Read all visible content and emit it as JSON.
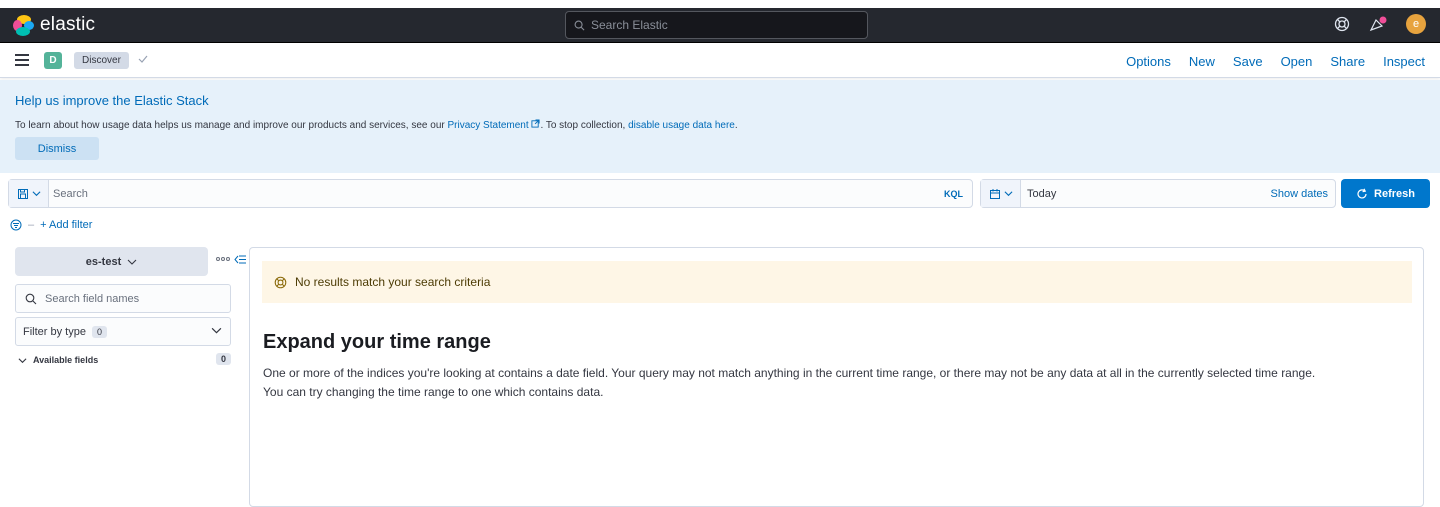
{
  "header": {
    "logo_text": "elastic",
    "search_placeholder": "Search Elastic",
    "avatar_initial": "e",
    "colors": {
      "bg": "#25282f",
      "avatar": "#e7a33e"
    }
  },
  "appbar": {
    "space_initial": "D",
    "breadcrumb": "Discover",
    "menu": [
      "Options",
      "New",
      "Save",
      "Open",
      "Share",
      "Inspect"
    ]
  },
  "callout": {
    "title": "Help us improve the Elastic Stack",
    "text_before": "To learn about how usage data helps us manage and improve our products and services, see our ",
    "privacy_link": "Privacy Statement",
    "text_middle": ". To stop collection, ",
    "disable_link": "disable usage data here",
    "text_after": ".",
    "dismiss_label": "Dismiss"
  },
  "query": {
    "placeholder": "Search",
    "language": "KQL",
    "date_label": "Today",
    "show_dates": "Show dates",
    "refresh_label": "Refresh",
    "add_filter": "+ Add filter"
  },
  "sidebar": {
    "index_pattern": "es-test",
    "field_search_placeholder": "Search field names",
    "filter_by_type": "Filter by type",
    "filter_count": "0",
    "available_fields": "Available fields",
    "available_count": "0"
  },
  "main": {
    "warning": "No results match your search criteria",
    "title": "Expand your time range",
    "line1": "One or more of the indices you're looking at contains a date field. Your query may not match anything in the current time range, or there may not be any data at all in the currently selected time range.",
    "line2": "You can try changing the time range to one which contains data."
  }
}
